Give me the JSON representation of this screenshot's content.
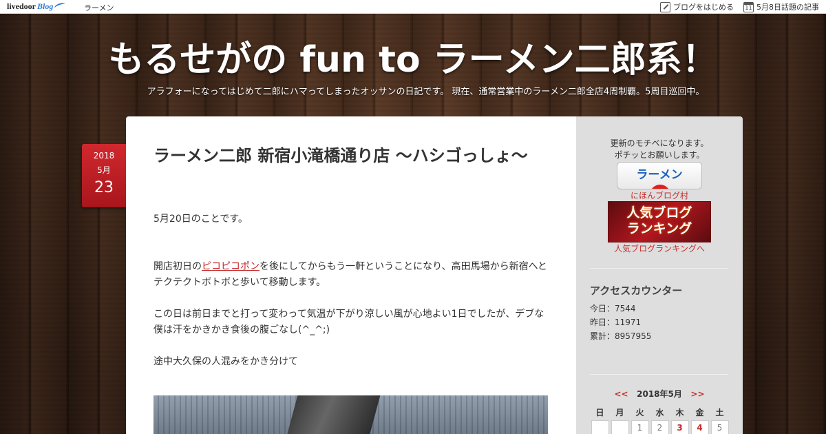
{
  "topbar": {
    "logo_text": "livedoor",
    "logo_blog": "Blog",
    "category": "ラーメン",
    "start_blog": "ブログをはじめる",
    "calendar_icon_day": "11",
    "trending": "5月8日話題の記事"
  },
  "header": {
    "title": "もるせがの fun to ラーメン二郎系！",
    "description": "アラフォーになってはじめて二郎にハマってしまったオッサンの日記です。 現在、通常営業中のラーメン二郎全店4周制覇。5周目巡回中。"
  },
  "post": {
    "date": {
      "year": "2018",
      "month": "5月",
      "day": "23"
    },
    "title": "ラーメン二郎 新宿小滝橋通り店 〜ハシゴっしょ〜",
    "p1": "5月20日のことです。",
    "p2_before": "開店初日の",
    "p2_link": "ピコピコポン",
    "p2_after": "を後にしてからもう一軒ということになり、高田馬場から新宿へとテクテクトボトボと歩いて移動します。",
    "p3": "この日は前日までと打って変わって気温が下がり涼しい風が心地よい1日でしたが、デブな僕は汗をかきかき食後の腹ごなし(^_^;)",
    "p4": "途中大久保の人混みをかき分けて"
  },
  "sidebar": {
    "motive_line1": "更新のモチベになります。",
    "motive_line2": "ポチッとお願いします。",
    "nihon_banner_text": "ラーメン",
    "nihon_link": "にほんブログ村",
    "ranking_banner_line1": "人気ブログ",
    "ranking_banner_line2": "ランキング",
    "ranking_link": "人気ブログランキングへ",
    "counter_heading": "アクセスカウンター",
    "today": "今日：7544",
    "yesterday": "昨日：11971",
    "total": "累計：8957955",
    "calendar": {
      "prev": "<<",
      "title": "2018年5月",
      "next": ">>",
      "weekdays": [
        "日",
        "月",
        "火",
        "水",
        "木",
        "金",
        "土"
      ],
      "first_row": [
        "",
        "",
        "1",
        "2",
        "3",
        "4",
        "5"
      ],
      "linked_days": [
        "3",
        "4"
      ]
    }
  },
  "colors": {
    "accent_red": "#c52a2a",
    "date_tab_red": "#d0282e",
    "sidebar_bg": "#dedede"
  }
}
